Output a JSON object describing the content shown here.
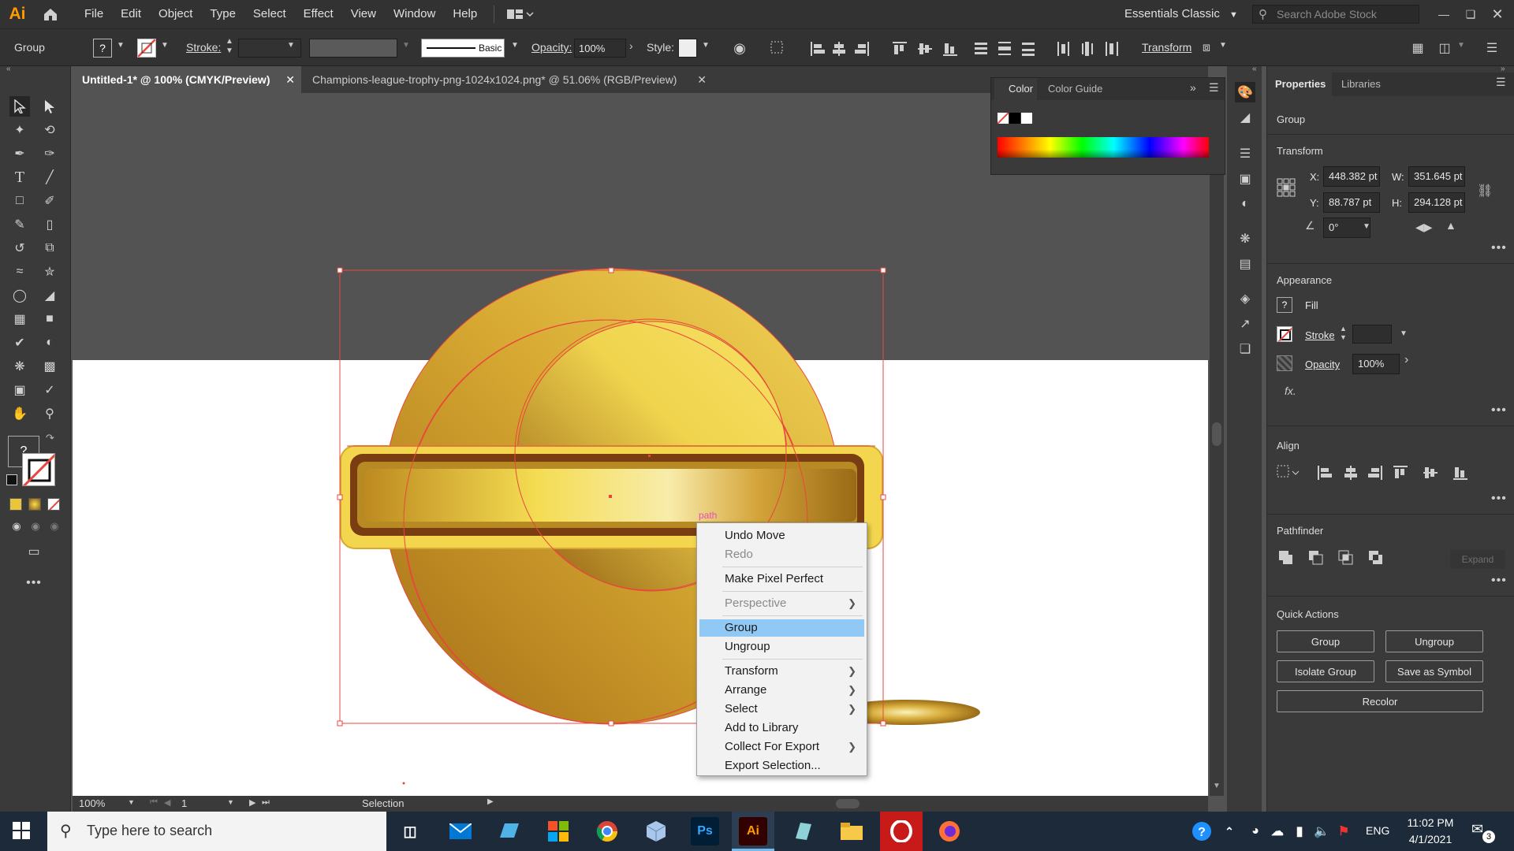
{
  "menubar": {
    "logo": "Ai",
    "items": [
      "File",
      "Edit",
      "Object",
      "Type",
      "Select",
      "Effect",
      "View",
      "Window",
      "Help"
    ],
    "workspace": "Essentials Classic",
    "search_placeholder": "Search Adobe Stock"
  },
  "controlbar": {
    "selection_type": "Group",
    "fill_unknown": "?",
    "stroke_label": "Stroke:",
    "brush_label": "Basic",
    "opacity_label": "Opacity:",
    "opacity_value": "100%",
    "style_label": "Style:",
    "transform_label": "Transform"
  },
  "tabs": [
    {
      "label": "Untitled-1* @ 100% (CMYK/Preview)",
      "active": true
    },
    {
      "label": "Champions-league-trophy-png-1024x1024.png* @ 51.06% (RGB/Preview)",
      "active": false
    }
  ],
  "color_panel": {
    "tab_color": "Color",
    "tab_color_guide": "Color Guide"
  },
  "properties": {
    "tab_properties": "Properties",
    "tab_libraries": "Libraries",
    "object_type": "Group",
    "transform_title": "Transform",
    "x_label": "X:",
    "x_value": "448.382 pt",
    "y_label": "Y:",
    "y_value": "88.787 pt",
    "w_label": "W:",
    "w_value": "351.645 pt",
    "h_label": "H:",
    "h_value": "294.128 pt",
    "angle_value": "0°",
    "appearance_title": "Appearance",
    "fill_label": "Fill",
    "stroke_label": "Stroke",
    "opacity_label": "Opacity",
    "opacity_value": "100%",
    "fx_label": "fx.",
    "align_title": "Align",
    "pathfinder_title": "Pathfinder",
    "expand_label": "Expand",
    "quick_actions_title": "Quick Actions",
    "qa_group": "Group",
    "qa_ungroup": "Ungroup",
    "qa_isolate": "Isolate Group",
    "qa_symbol": "Save as Symbol",
    "qa_recolor": "Recolor"
  },
  "canvas": {
    "hover_label": "path"
  },
  "context_menu": {
    "items": [
      {
        "label": "Undo Move",
        "disabled": false
      },
      {
        "label": "Redo",
        "disabled": true
      },
      {
        "label": "Make Pixel Perfect",
        "disabled": false
      },
      {
        "label": "Perspective",
        "disabled": true,
        "submenu": true
      },
      {
        "label": "Group",
        "disabled": false,
        "highlighted": true
      },
      {
        "label": "Ungroup",
        "disabled": false
      },
      {
        "label": "Transform",
        "submenu": true
      },
      {
        "label": "Arrange",
        "submenu": true
      },
      {
        "label": "Select",
        "submenu": true
      },
      {
        "label": "Add to Library"
      },
      {
        "label": "Collect For Export",
        "submenu": true
      },
      {
        "label": "Export Selection..."
      }
    ]
  },
  "statusbar": {
    "zoom": "100%",
    "artboard": "1",
    "tool": "Selection"
  },
  "taskbar": {
    "search_placeholder": "Type here to search",
    "language": "ENG",
    "time": "11:02 PM",
    "date": "4/1/2021",
    "notifications": "3",
    "photoshop_label": "Ps",
    "illustrator_label": "Ai"
  },
  "colors": {
    "accent_red": "#e8473d",
    "menu_highlight": "#90c8f6",
    "gold_light": "#f6dc55",
    "gold_dark": "#a9761c"
  }
}
